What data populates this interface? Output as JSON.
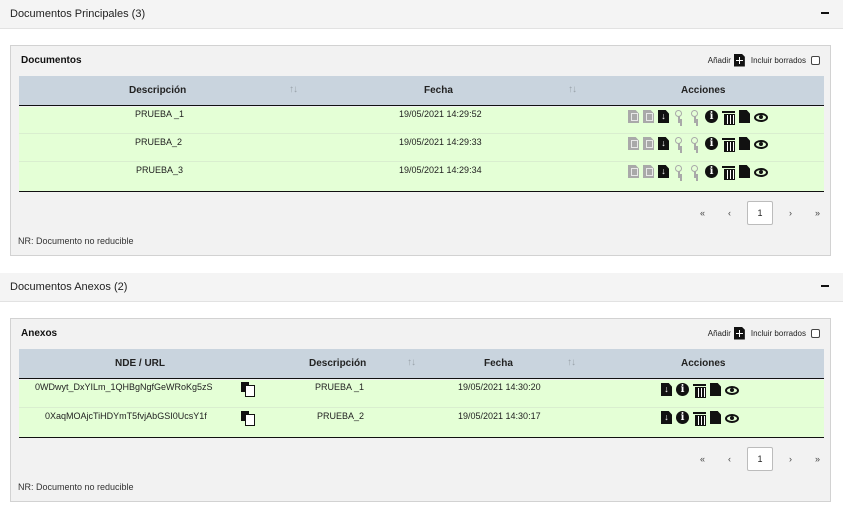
{
  "principales": {
    "section_title": "Documentos Principales (3)",
    "panel_title": "Documentos",
    "add_label": "Añadir",
    "include_deleted_label": "Incluir borrados",
    "columns": {
      "descripcion": "Descripción",
      "fecha": "Fecha",
      "acciones": "Acciones"
    },
    "rows": [
      {
        "descripcion": "PRUEBA _1",
        "fecha": "19/05/2021 14:29:52"
      },
      {
        "descripcion": "PRUEBA_2",
        "fecha": "19/05/2021 14:29:33"
      },
      {
        "descripcion": "PRUEBA_3",
        "fecha": "19/05/2021 14:29:34"
      }
    ],
    "pagination": {
      "first": "«",
      "prev": "‹",
      "current": "1",
      "next": "›",
      "last": "»"
    },
    "note": "NR: Documento no reducible"
  },
  "anexos": {
    "section_title": "Documentos Anexos (2)",
    "panel_title": "Anexos",
    "add_label": "Añadir",
    "include_deleted_label": "Incluir borrados",
    "columns": {
      "nde": "NDE / URL",
      "descripcion": "Descripción",
      "fecha": "Fecha",
      "acciones": "Acciones"
    },
    "rows": [
      {
        "nde": "0WDwyt_DxYILm_1QHBgNgfGeWRoKg5zS",
        "descripcion": "PRUEBA _1",
        "fecha": "19/05/2021 14:30:20"
      },
      {
        "nde": "0XaqMOAjcTiHDYmT5fvjAbGSI0UcsY1f",
        "descripcion": "PRUEBA_2",
        "fecha": "19/05/2021 14:30:17"
      }
    ],
    "pagination": {
      "first": "«",
      "prev": "‹",
      "current": "1",
      "next": "›",
      "last": "»"
    },
    "note": "NR: Documento no reducible"
  },
  "icons": {
    "sort": "sort-icon",
    "principal_actions": [
      "signature-doc-icon",
      "signed-doc-icon",
      "download-icon",
      "key-icon",
      "key-icon",
      "info-icon",
      "delete-icon",
      "document-icon",
      "view-icon"
    ],
    "anexo_actions": [
      "download-icon",
      "info-icon",
      "delete-icon",
      "document-icon",
      "view-icon"
    ],
    "copy": "copy-icon"
  },
  "colors": {
    "header_bg": "#c9d4de",
    "row_bg": "#e4ffd6",
    "panel_bg": "#f2f2f2"
  }
}
